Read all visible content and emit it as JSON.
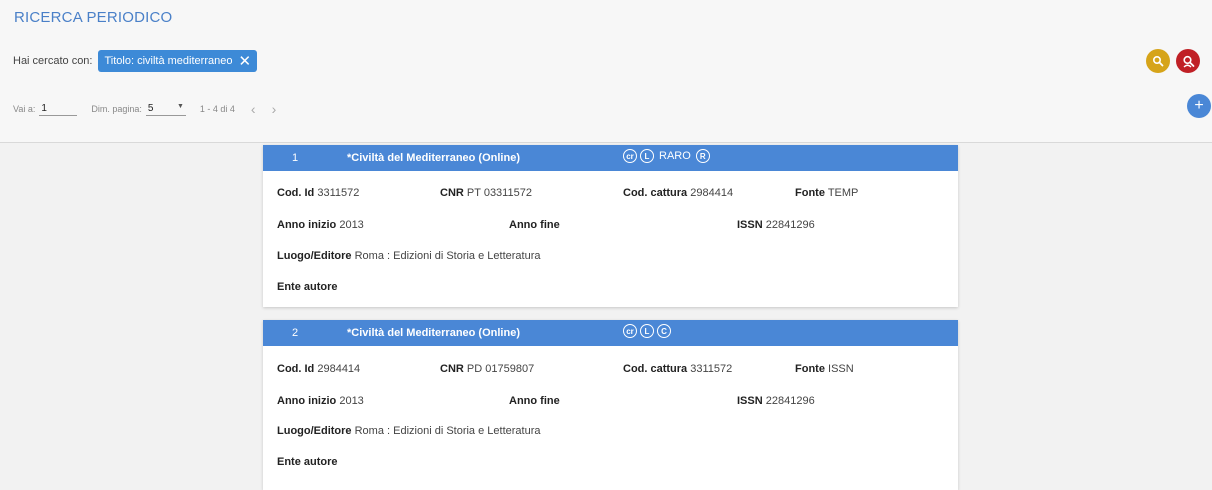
{
  "header": {
    "title": "RICERCA PERIODICO",
    "search_label": "Hai cercato con:",
    "chip_label": "Titolo: civiltà mediterraneo",
    "chip_remove": "✕"
  },
  "pager": {
    "goto_label": "Vai a:",
    "goto_value": "1",
    "size_label": "Dim. pagina:",
    "size_value": "5",
    "count": "1 - 4 di 4",
    "prev": "‹",
    "next": "›"
  },
  "actions": {
    "search_icon": "search-icon",
    "advanced_search_icon": "person-search-icon",
    "add_icon": "plus-icon",
    "colors": {
      "yellow": "#d6a419",
      "red": "#c02026",
      "blue": "#4a87d6"
    }
  },
  "labels": {
    "cod_id": "Cod. Id",
    "cnr": "CNR",
    "cod_cattura": "Cod. cattura",
    "fonte": "Fonte",
    "anno_inizio": "Anno inizio",
    "anno_fine": "Anno fine",
    "issn": "ISSN",
    "luogo_editore": "Luogo/Editore",
    "ente_autore": "Ente autore"
  },
  "results": [
    {
      "index": "1",
      "title": "*Civiltà del Mediterraneo (Online)",
      "badge1": "cr",
      "badge2": "L",
      "badge_text": "RARO",
      "badge3": "R",
      "cod_id": "3311572",
      "cnr": "PT 03311572",
      "cod_cattura": "2984414",
      "fonte": "TEMP",
      "anno_inizio": "2013",
      "anno_fine": "",
      "issn": "22841296",
      "luogo_editore": "Roma : Edizioni di Storia e Letteratura",
      "ente_autore": ""
    },
    {
      "index": "2",
      "title": "*Civiltà del Mediterraneo (Online)",
      "badge1": "cr",
      "badge2": "L",
      "badge3": "C",
      "cod_id": "2984414",
      "cnr": "PD 01759807",
      "cod_cattura": "3311572",
      "fonte": "ISSN",
      "anno_inizio": "2013",
      "anno_fine": "",
      "issn": "22841296",
      "luogo_editore": "Roma : Edizioni di Storia e Letteratura",
      "ente_autore": ""
    }
  ]
}
